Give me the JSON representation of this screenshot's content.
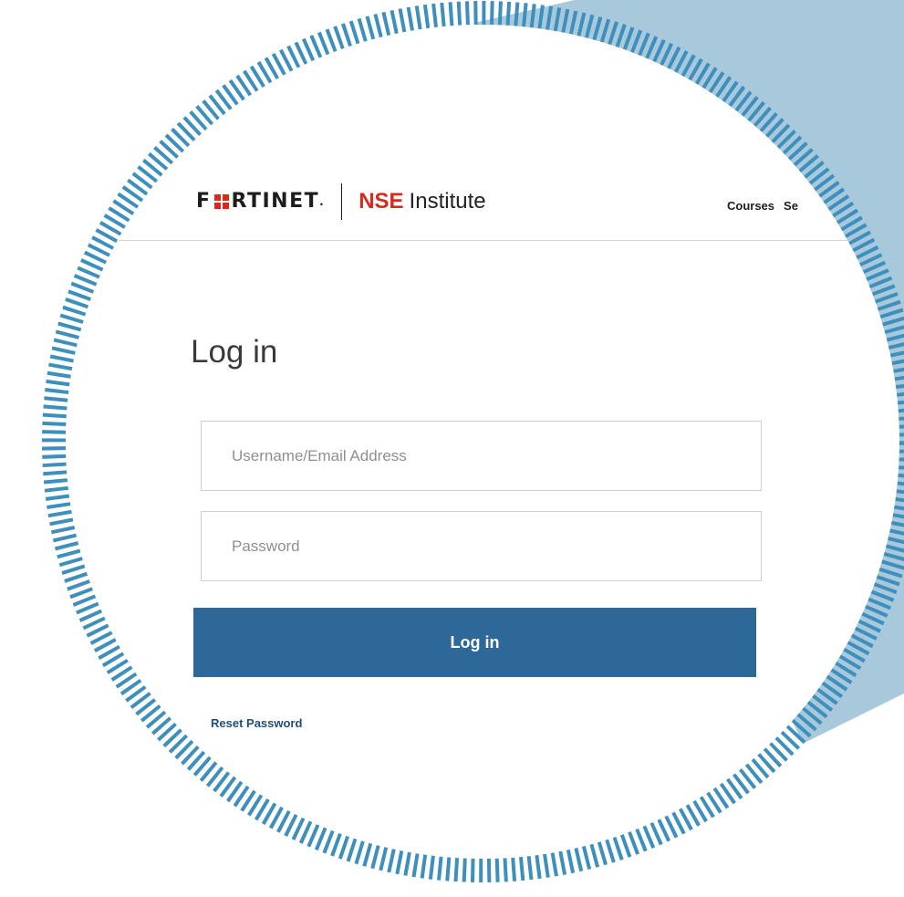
{
  "header": {
    "brand_left": "F",
    "brand_right": "RTINET",
    "brand_mark": ".",
    "product_accent": "NSE",
    "product_name": "Institute",
    "nav": [
      {
        "label": "Courses"
      },
      {
        "label": "Se"
      }
    ]
  },
  "form": {
    "title": "Log in",
    "username": {
      "value": "",
      "placeholder": "Username/Email Address"
    },
    "password": {
      "value": "",
      "placeholder": "Password"
    },
    "submit_label": "Log in",
    "reset_label": "Reset Password"
  },
  "colors": {
    "brand_red": "#da291c",
    "primary_button": "#2d6899",
    "frame_blue": "#a8c9dc",
    "ring_blue": "#3f8fbd",
    "link": "#1f4e79"
  }
}
